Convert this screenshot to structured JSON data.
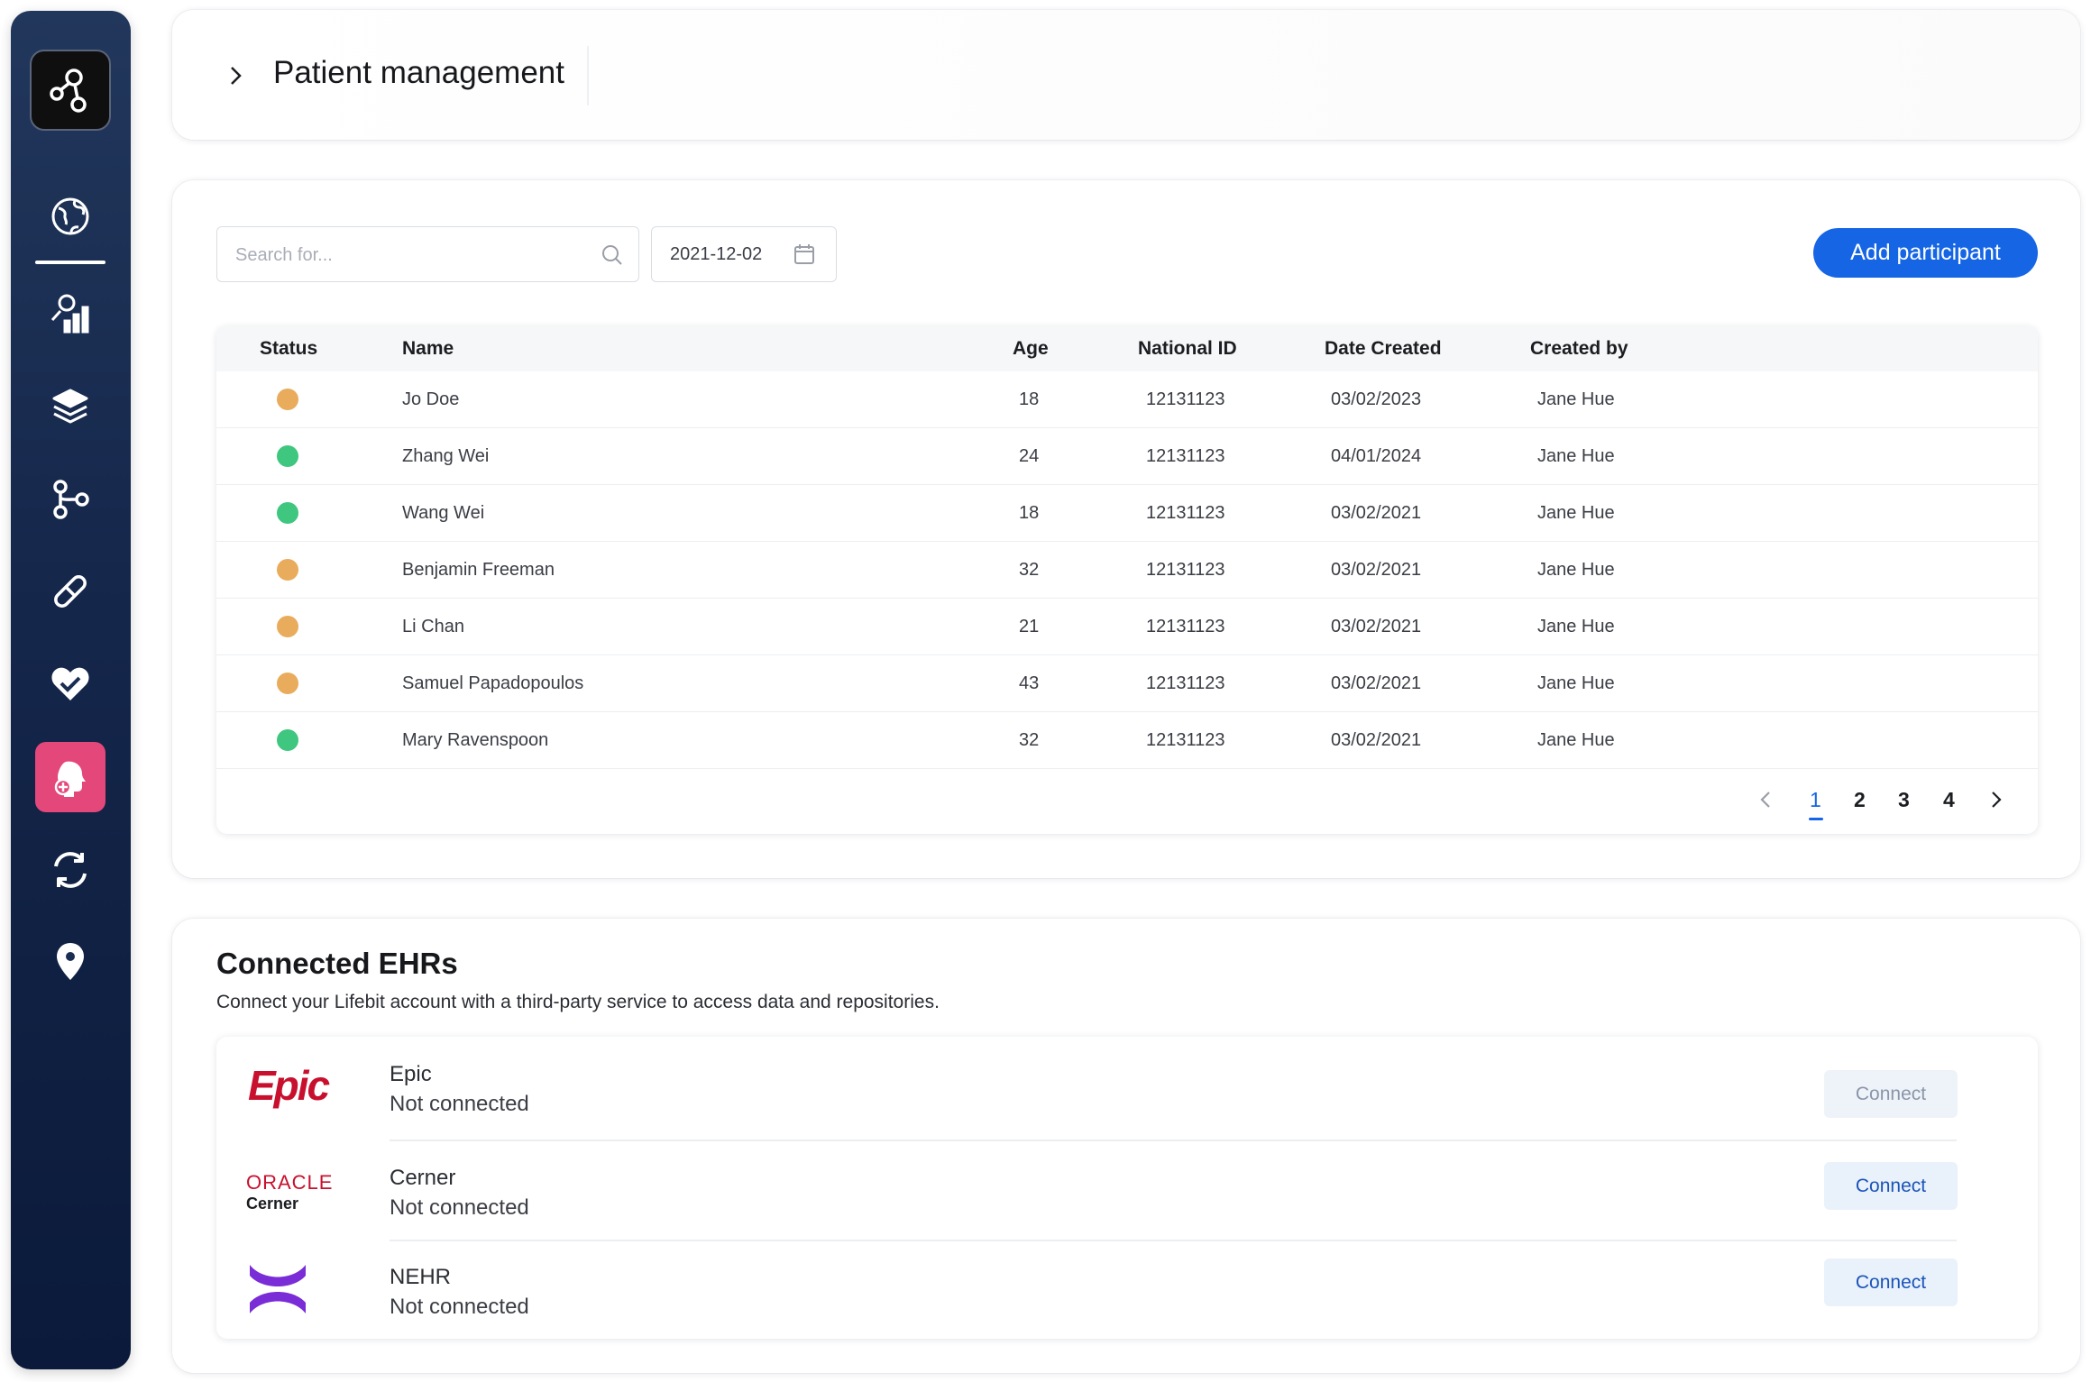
{
  "header": {
    "title": "Patient management"
  },
  "toolbar": {
    "search_placeholder": "Search for...",
    "date_value": "2021-12-02",
    "add_label": "Add participant"
  },
  "table": {
    "columns": [
      "Status",
      "Name",
      "Age",
      "National ID",
      "Date Created",
      "Created by"
    ],
    "rows": [
      {
        "status": "pending",
        "name": "Jo Doe",
        "age": "18",
        "national_id": "12131123",
        "date_created": "03/02/2023",
        "created_by": "Jane Hue"
      },
      {
        "status": "active",
        "name": "Zhang Wei",
        "age": "24",
        "national_id": "12131123",
        "date_created": "04/01/2024",
        "created_by": "Jane Hue"
      },
      {
        "status": "active",
        "name": "Wang Wei",
        "age": "18",
        "national_id": "12131123",
        "date_created": "03/02/2021",
        "created_by": "Jane Hue"
      },
      {
        "status": "pending",
        "name": "Benjamin Freeman",
        "age": "32",
        "national_id": "12131123",
        "date_created": "03/02/2021",
        "created_by": "Jane Hue"
      },
      {
        "status": "pending",
        "name": "Li Chan",
        "age": "21",
        "national_id": "12131123",
        "date_created": "03/02/2021",
        "created_by": "Jane Hue"
      },
      {
        "status": "pending",
        "name": "Samuel Papadopoulos",
        "age": "43",
        "national_id": "12131123",
        "date_created": "03/02/2021",
        "created_by": "Jane Hue"
      },
      {
        "status": "active",
        "name": "Mary Ravenspoon",
        "age": "32",
        "national_id": "12131123",
        "date_created": "03/02/2021",
        "created_by": "Jane Hue"
      }
    ],
    "status_colors": {
      "pending": "#e9ab5c",
      "active": "#3fc67f"
    }
  },
  "pagination": {
    "pages": [
      "1",
      "2",
      "3",
      "4"
    ],
    "current": "1"
  },
  "ehrs": {
    "title": "Connected EHRs",
    "subtitle": "Connect your Lifebit account with a third-party service to access data and repositories.",
    "items": [
      {
        "name": "Epic",
        "status": "Not connected",
        "button": "Connect",
        "logo_text": "Epic"
      },
      {
        "name": "Cerner",
        "status": "Not connected",
        "button": "Connect",
        "logo_text": "ORACLE",
        "logo_sub": "Cerner"
      },
      {
        "name": "NEHR",
        "status": "Not connected",
        "button": "Connect"
      }
    ]
  },
  "sidebar": {
    "icons": [
      "lifebit-logo-icon",
      "globe-icon",
      "analytics-icon",
      "layers-icon",
      "workflow-icon",
      "pill-icon",
      "heart-check-icon",
      "patient-icon",
      "sync-icon",
      "location-icon"
    ]
  },
  "colors": {
    "accent": "#1565e5",
    "active_nav": "#e4477a",
    "sidebar": "#16284c"
  }
}
